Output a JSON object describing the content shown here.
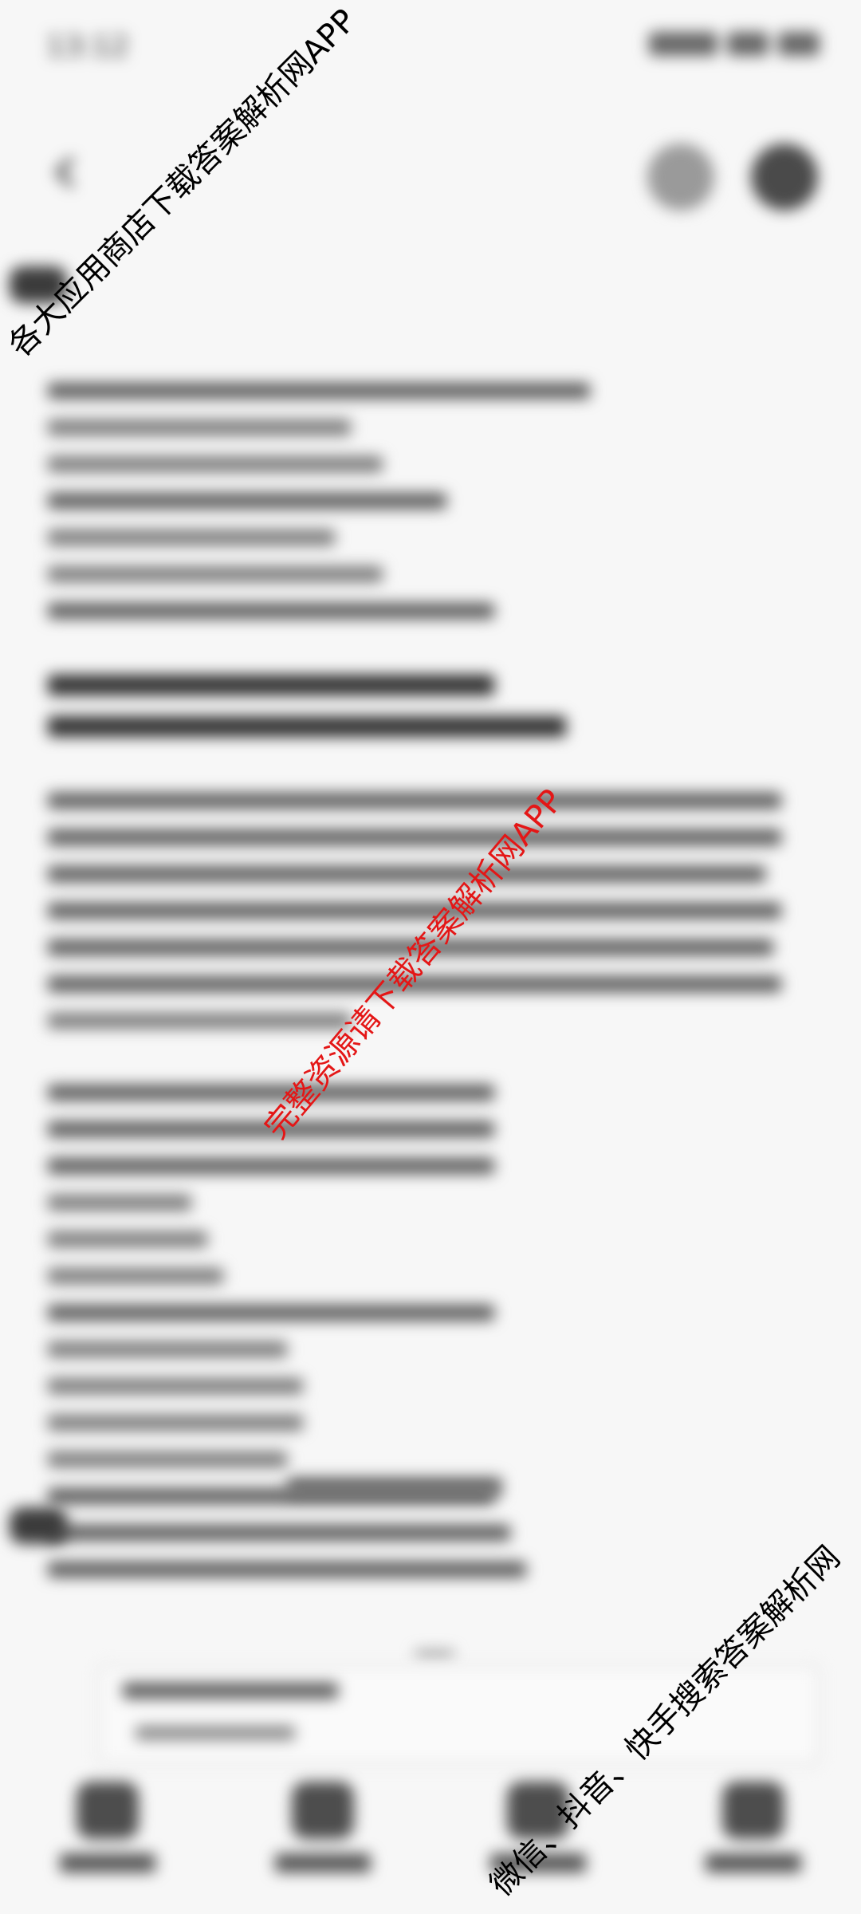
{
  "status_bar": {
    "time": "13:12"
  },
  "header": {
    "back_icon": "chevron-left-icon",
    "actions": [
      "clock-icon",
      "grid-icon"
    ]
  },
  "watermarks": {
    "top_left": "各大应用商店下载答案解析网APP",
    "center": "完整资源请下载答案解析网APP",
    "bottom_right": "微信、抖音、快手搜索答案解析网"
  },
  "bottom_nav": {
    "items": [
      "home-icon",
      "document-icon",
      "share-icon",
      "more-icon"
    ]
  },
  "colors": {
    "watermark_red": "#e41616",
    "background": "#f7f7f7"
  }
}
